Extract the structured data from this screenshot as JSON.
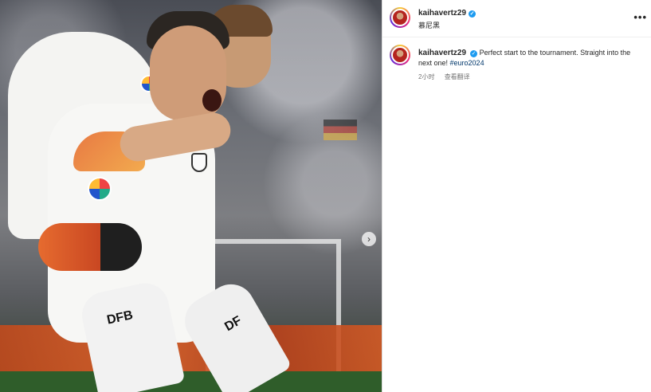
{
  "post": {
    "media": {
      "sock_text_left": "DFB",
      "sock_text_right": "DF"
    },
    "next_icon": "chevron-right-icon"
  },
  "header": {
    "username": "kaihavertz29",
    "verified_icon": "verified-badge-icon",
    "location": "慕尼黑",
    "more_icon": "more-horizontal-icon"
  },
  "caption": {
    "username": "kaihavertz29",
    "text": "Perfect start to the tournament. Straight into the next one! ",
    "hashtag": "#euro2024",
    "time_ago": "2小时",
    "translate_label": "查看翻译"
  },
  "colors": {
    "verified": "#1d9bf0",
    "hashtag": "#00376b",
    "meta_text": "#737373"
  }
}
